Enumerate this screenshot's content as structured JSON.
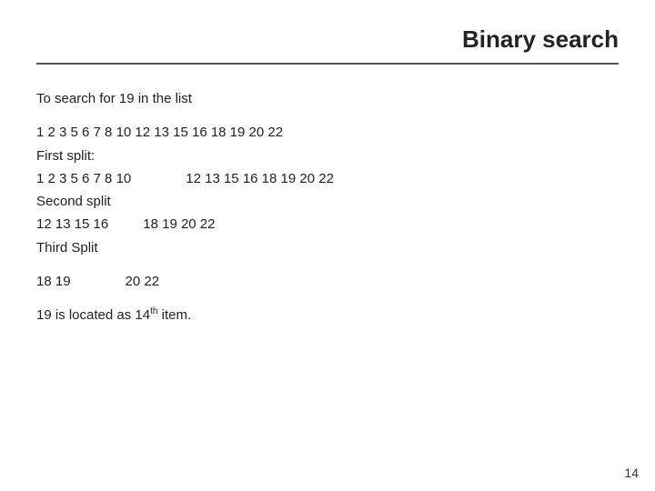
{
  "title": "Binary search",
  "divider": true,
  "intro": "To search for 19 in the list",
  "list_line": "1 2 3 5 6 7 8 10 12 13 15 16 18 19 20 22",
  "first_split_label": "First split:",
  "first_split_left": "1 2 3 5 6 7 8 10",
  "first_split_right": "12 13 15 16 18 19 20 22",
  "second_split_label": "Second split",
  "second_split_left": "12 13 15 16",
  "second_split_right": "18 19 20 22",
  "third_split_label": "Third Split",
  "fourth_line_left": "18 19",
  "fourth_line_right": "20 22",
  "conclusion_prefix": "19 is located as 14",
  "conclusion_sup": "th",
  "conclusion_suffix": " item.",
  "page_number": "14"
}
